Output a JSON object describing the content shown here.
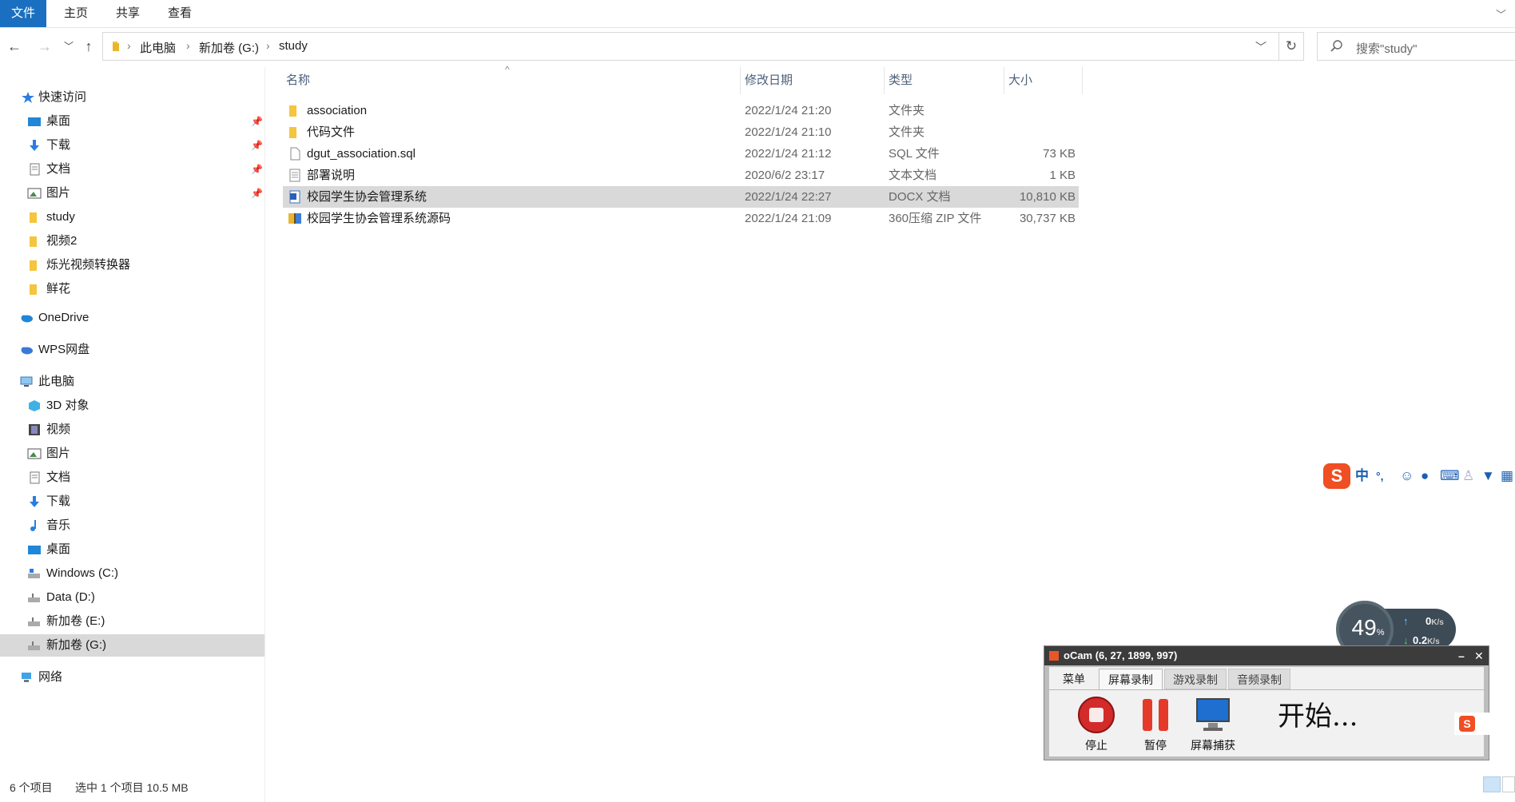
{
  "ribbon": {
    "file": "文件",
    "home": "主页",
    "share": "共享",
    "view": "查看"
  },
  "address": {
    "crumbs": [
      "此电脑",
      "新加卷 (G:)",
      "study"
    ],
    "search_placeholder": "搜索\"study\""
  },
  "sidebar": {
    "quick_access": "快速访问",
    "quick_items": [
      "桌面",
      "下载",
      "文档",
      "图片",
      "study",
      "视频2",
      "烁光视频转换器",
      "鲜花"
    ],
    "onedrive": "OneDrive",
    "wps": "WPS网盘",
    "this_pc": "此电脑",
    "pc_items": [
      "3D 对象",
      "视频",
      "图片",
      "文档",
      "下载",
      "音乐",
      "桌面",
      "Windows (C:)",
      "Data (D:)",
      "新加卷 (E:)",
      "新加卷 (G:)"
    ],
    "network": "网络"
  },
  "columns": {
    "name": "名称",
    "date": "修改日期",
    "type": "类型",
    "size": "大小"
  },
  "files": [
    {
      "name": "association",
      "date": "2022/1/24 21:20",
      "type": "文件夹",
      "size": "",
      "icon": "folder-icon"
    },
    {
      "name": "代码文件",
      "date": "2022/1/24 21:10",
      "type": "文件夹",
      "size": "",
      "icon": "folder-icon"
    },
    {
      "name": "dgut_association.sql",
      "date": "2022/1/24 21:12",
      "type": "SQL 文件",
      "size": "73 KB",
      "icon": "file-icon"
    },
    {
      "name": "部署说明",
      "date": "2020/6/2 23:17",
      "type": "文本文档",
      "size": "1 KB",
      "icon": "text-file-icon"
    },
    {
      "name": "校园学生协会管理系统",
      "date": "2022/1/24 22:27",
      "type": "DOCX 文档",
      "size": "10,810 KB",
      "icon": "docx-icon"
    },
    {
      "name": "校园学生协会管理系统源码",
      "date": "2022/1/24 21:09",
      "type": "360压缩 ZIP 文件",
      "size": "30,737 KB",
      "icon": "zip-icon"
    }
  ],
  "status": {
    "count": "6 个项目",
    "selected": "选中 1 个项目  10.5 MB"
  },
  "ime": {
    "lang": "中",
    "punct": "°,"
  },
  "speed": {
    "percent": "49",
    "unit": "%",
    "up": "0",
    "down": "0.2",
    "rate_unit": "K/s"
  },
  "ocam": {
    "title": "oCam (6, 27, 1899, 997)",
    "tabs": [
      "菜单",
      "屏幕录制",
      "游戏录制",
      "音频录制"
    ],
    "buttons": [
      "停止",
      "暂停",
      "屏幕捕获"
    ],
    "state": "开始..."
  },
  "colors": {
    "accent": "#1a6fc0",
    "selected_row": "#d9d9d9",
    "folder": "#f4c53d"
  }
}
